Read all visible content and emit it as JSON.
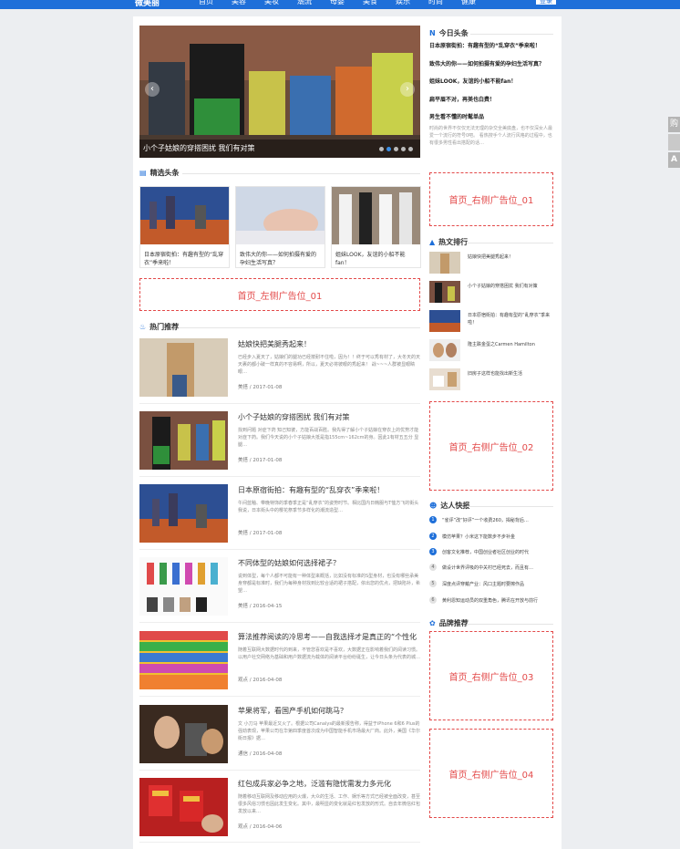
{
  "header": {
    "logo": "微美丽",
    "nav": [
      "首页",
      "美容",
      "美妆",
      "潮流",
      "母婴",
      "美食",
      "娱乐",
      "时尚",
      "健康"
    ],
    "login": "登录"
  },
  "slider": {
    "caption": "小个子姑娘的穿搭困扰 我们有对策",
    "prev": "‹",
    "next": "›"
  },
  "featured": {
    "title": "精选头条",
    "cards": [
      {
        "title": "日本原宿街拍：有趣有型的“乱穿衣”季来啦！"
      },
      {
        "title": "致伟大的你——如何拍摄有爱的孕妇生活写真？"
      },
      {
        "title": "姐妹LOOK，友谊的小船不能fan！"
      }
    ]
  },
  "ads": {
    "left01": "首页_左侧广告位_01",
    "right01": "首页_右侧广告位_01",
    "right02": "首页_右侧广告位_02",
    "right03": "首页_右侧广告位_03",
    "right04": "首页_右侧广告位_04"
  },
  "hot_recommend": {
    "title": "热门推荐",
    "items": [
      {
        "title": "姑娘快把美腿秀起来！",
        "desc": "已经步入夏天了，姑娘们的腿功已经按耐不住啦，因为！！终于可以秀有材了，大冬天的天天裹的都小破一样真的不容易啊，所以，夏天必将彼眼的秀起来！ 战~~~人群被显眼睛 眼…",
        "meta": "美搭 / 2017-01-08"
      },
      {
        "title": "小个子姑娘的穿搭困扰 我们有对策",
        "desc": "找到问题 对症下药 知己知彼，方能百战百胜。我先得了解小个子姑娘在穿衣上的优势才能对症下药。我们今天说的小个子姑娘大抵是指155cm~162cm的身。因此1有材五五分 显腿…",
        "meta": "美搭 / 2017-01-08"
      },
      {
        "title": "日本原宿街拍：有趣有型的“乱穿衣”季来啦！",
        "desc": "午间蓝釉、带晚特饰的季春季正是“乱穿衣”的姿势时节。相比国内日韩服与T恤方飞的街头我说，日本街头中的樱花祭季节多样化的潮流造型…",
        "meta": "美搭 / 2017-01-08"
      },
      {
        "title": "不同体型的姑娘如何选择裙子？",
        "desc": "说到体型，每个人都不可能有一种体型来概括，比如没有标准的S型身材，也没有哪些承美身穿都是标准时，我们为每种身材找到比较合适的裙子搭配，依出您的优点，把缺陷补，希望…",
        "meta": "美搭 / 2016-04-15"
      },
      {
        "title": "算法推荐阅读的冷思考——自我选择才是真正的“个性化",
        "desc": "随着互联网大数据时代的到来，不管您喜欢是不喜欢，大数据正在影响着我们的阅读习惯。以用户社交网络为基础和用户数据流为载体的阅读平台纷纷诞生，让今日头条为代表的城…",
        "meta": "观点 / 2016-04-08"
      },
      {
        "title": "苹果将军，看国产手机如何跳马？",
        "desc": "文 小刀马 苹果最近又火了。根据公司Canalys的最新报告称，得益于iPhone 6和6 Plus的强劲表现，苹果公司在华第四季度首次成为中国智能手机市场最大厂商。此外，美国《华尔街日报》据…",
        "meta": "通信 / 2016-04-08"
      },
      {
        "title": "红包成兵家必争之地，泛滥有隐忧需发力多元化",
        "desc": "随着移动互联网及移动应用的火爆，大众的生活、工作、娱乐等方式已经被全面改变，甚至很多风俗习惯也因此发生变化。其中，最明显的变化就是红包发放的形式。自去年微信红包发放以来…",
        "meta": "观点 / 2016-04-06"
      }
    ]
  },
  "today_news": {
    "title": "今日头条",
    "items": [
      "日本原宿街拍：有趣有型的“乱穿衣”季来啦！",
      "致伟大的你——如何拍摄有爱的孕妇生活写真？",
      "姐妹LOOK，友谊的小船不能fan！",
      "扁平眉不对，再美也白费！",
      "男生看不懂的时髦单品"
    ],
    "desc": "时尚的世界不仅仅无法无理的杂交全美底盘，也不仅深女人最爱一个流行的符号0吧。 看热搜手个人流行风格的过程中，也有很多男性看出搭配的话…"
  },
  "hot_list": {
    "title": "热文排行",
    "items": [
      "姑娘快把美腿秀起来！",
      "小个子姑娘的穿搭困扰 我们有对策",
      "日本原宿街拍：有趣有型的“乱穿衣”季来啦！",
      "隆主跌金蛋之Carmen Hamilton",
      "旧房子这样也能找出新生活"
    ]
  },
  "flash": {
    "title": "达人快报",
    "items": [
      "“雀评”改“好评”一个收费260，揭秘背后…",
      "模仿苹果？小米这下能数步不步补金",
      "创客文化推荐，中国创业者社区创业的时代",
      "做设计世界评吸的中关村已经死去，而且有…",
      "深度点评穿戴产业：风口主题时要擦作品",
      "黄利恩知运动员的双重角色，腾讯在开放与前行"
    ]
  },
  "brand": {
    "title": "品牌推荐"
  },
  "side_tools": [
    "购",
    "A"
  ],
  "colors": {
    "accent": "#1e6fd9",
    "ad": "#e34a4a"
  }
}
